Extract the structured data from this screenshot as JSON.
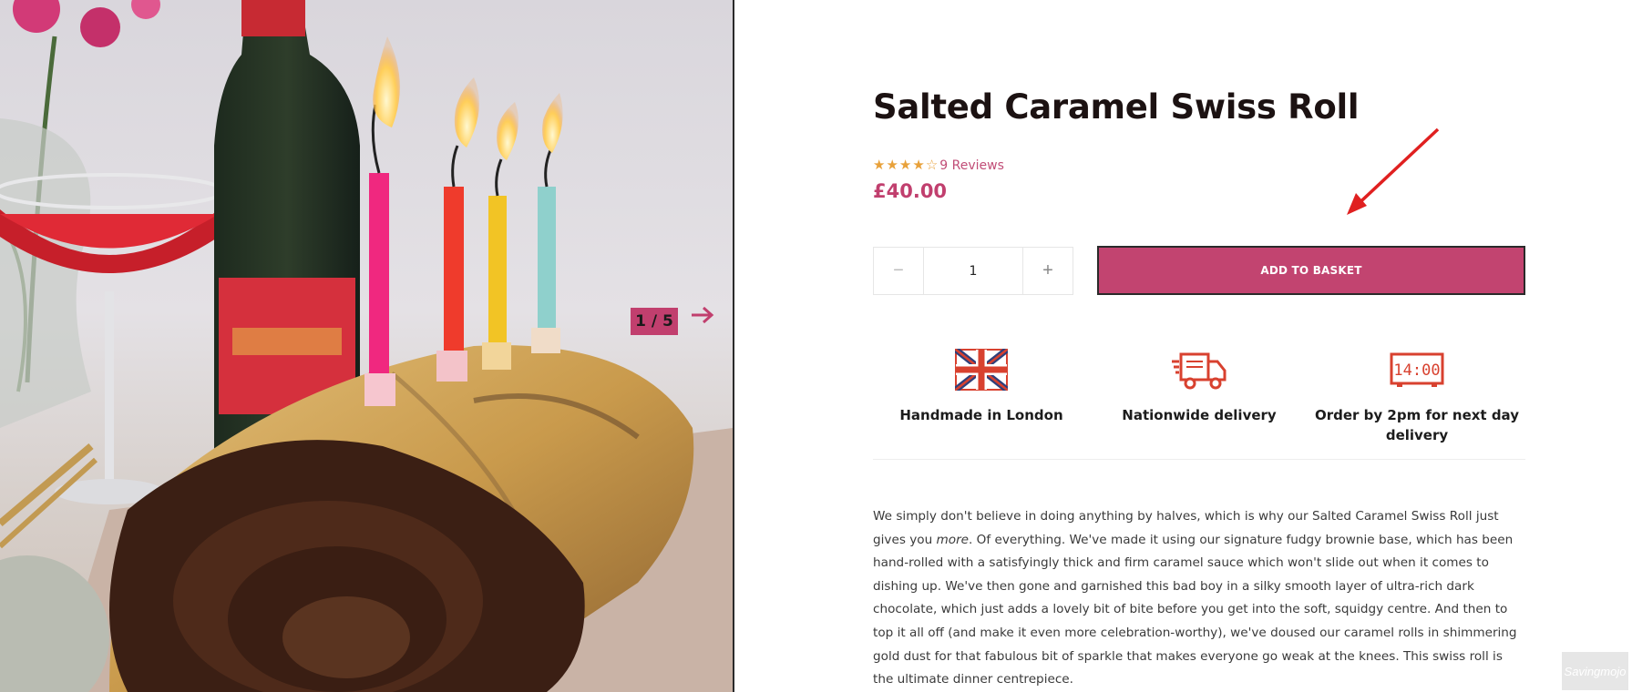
{
  "gallery": {
    "counter": "1 / 5",
    "next_icon": "arrow-right-icon",
    "photo_label": "Salted Caramel Swiss Roll with candles"
  },
  "product": {
    "title": "Salted Caramel Swiss Roll",
    "rating": {
      "value": 4,
      "max": 5,
      "reviews_text": "9 Reviews"
    },
    "price": "£40.00",
    "quantity": {
      "value": "1",
      "minus": "−",
      "plus": "+"
    },
    "add_to_basket": "ADD TO BASKET"
  },
  "features": [
    {
      "icon": "union-jack-icon",
      "label": "Handmade in London"
    },
    {
      "icon": "delivery-truck-icon",
      "label": "Nationwide delivery"
    },
    {
      "icon": "clock-1400-icon",
      "label": "Order by 2pm for next day delivery",
      "clock_text": "14:00"
    }
  ],
  "description": {
    "part1": "We simply don't believe in doing anything by halves, which is why our Salted Caramel Swiss Roll just gives you ",
    "emphasis": "more",
    "part2": ". Of everything. We've made it using our signature fudgy brownie base, which has been hand-rolled with a satisfyingly thick and firm caramel sauce which won't slide out when it comes to dishing up. We've then gone and garnished this bad boy in a silky smooth layer of ultra-rich dark chocolate, which just adds a lovely bit of bite before you get into the soft, squidgy centre. And then to top it all off (and make it even more celebration-worthy), we've doused our caramel rolls in shimmering gold dust for that fabulous bit of sparkle that makes everyone go weak at the knees. This swiss roll is the ultimate dinner centrepiece."
  },
  "watermark": "Savingmojo",
  "colors": {
    "brand": "#c24470",
    "star": "#e8a13a",
    "annotation_arrow": "#e02020",
    "icon_red": "#d8412f"
  }
}
